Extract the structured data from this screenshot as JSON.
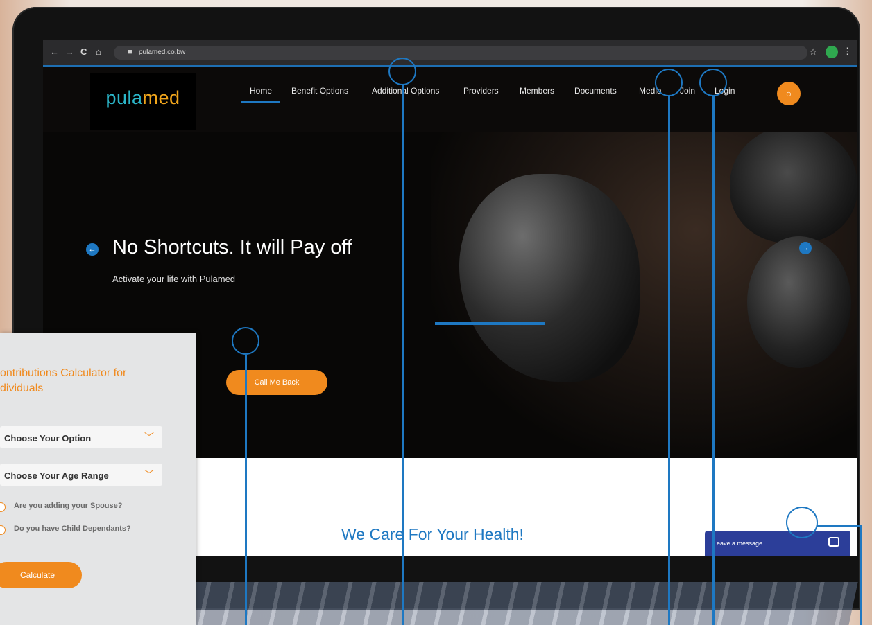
{
  "browser": {
    "url": "pulamed.co.bw",
    "back_glyph": "←",
    "forward_glyph": "→",
    "reload_glyph": "C",
    "home_glyph": "⌂",
    "lock_glyph": "■",
    "star_glyph": "☆",
    "menu_glyph": "⋮"
  },
  "site": {
    "logo_part1": "pula",
    "logo_part2": "med",
    "nav": [
      "Home",
      "Benefit Options",
      "Additional Options",
      "Providers",
      "Members",
      "Documents",
      "Media",
      "Join",
      "Login"
    ],
    "search_glyph": "○"
  },
  "hero": {
    "headline": "No Shortcuts. It will Pay off",
    "subline": "Activate your life with Pulamed",
    "cta_label": "Call Me Back",
    "slide_progress": 0.17,
    "prev_glyph": "←",
    "next_glyph": "→"
  },
  "content": {
    "heading": "We Care For Your Health!",
    "chat_label": "Leave a message"
  },
  "calculator": {
    "title": "ontributions Calculator for dividuals",
    "option_select": "Choose Your Option",
    "age_select": "Choose Your Age Range",
    "spouse_label": "Are you adding your Spouse?",
    "dependants_label": "Do you have Child Dependants?",
    "button_label": "Calculate",
    "chevron_glyph": "﹀"
  },
  "colors": {
    "accent_orange": "#f08a1e",
    "accent_blue": "#1e78c2",
    "logo_teal": "#2bb6c9",
    "logo_gold": "#f0a51c"
  }
}
